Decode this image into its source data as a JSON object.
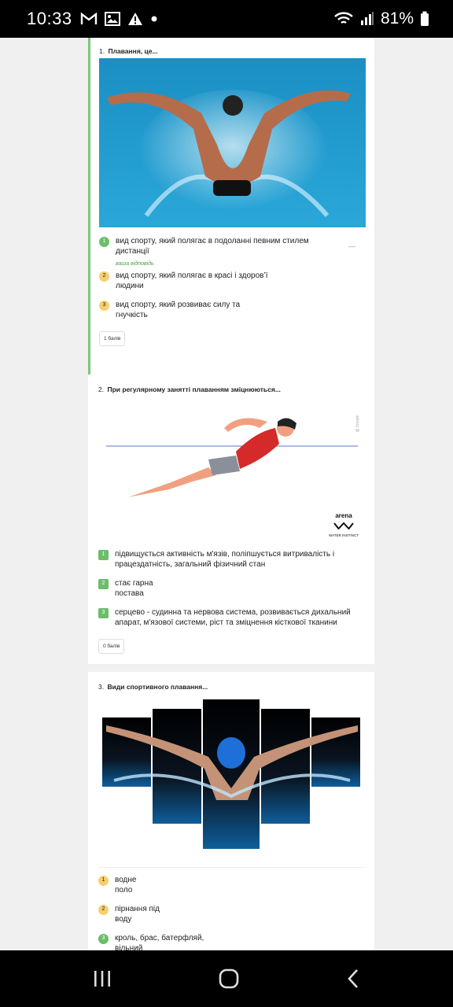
{
  "status": {
    "time": "10:33",
    "battery": "81%"
  },
  "questions": [
    {
      "number": "1.",
      "title": "Плавання, це...",
      "answers": [
        {
          "n": "1",
          "text": "вид спорту, який полягає в подоланні певним стилем дистанції"
        },
        {
          "n": "2",
          "text": "вид спорту, який полягає в красі і здоров’ї людини"
        },
        {
          "n": "3",
          "text": "вид спорту, який розвиває силу та гнучкість"
        }
      ],
      "your_answer": "ваша відповідь",
      "dash": "—",
      "score": "1 балів"
    },
    {
      "number": "2.",
      "title": "При регулярному занятті плаванням зміцнюються...",
      "image_text": {
        "brand": "arena",
        "tagline": "WATER INSTINCT",
        "watermark": "@ freepik"
      },
      "answers": [
        {
          "n": "1",
          "text": "підвищується активність м'язів, поліпшується витривалість і працездатність, загальний фізичний стан"
        },
        {
          "n": "2",
          "text": "стає гарна постава"
        },
        {
          "n": "3",
          "text": "серцево - судинна та нервова система, розвивається дихальний апарат, м'язової системи, ріст та зміцнення кісткової тканини"
        }
      ],
      "score": "0 балів"
    },
    {
      "number": "3.",
      "title": "Види спортивного плавання...",
      "answers": [
        {
          "n": "1",
          "text": "водне поло"
        },
        {
          "n": "2",
          "text": " пірнання під воду"
        },
        {
          "n": "3",
          "text": "кроль, брас, батерфляй, вільний"
        }
      ]
    }
  ],
  "colors": {
    "correct": "#6cbd6c",
    "neutral": "#f6d06e",
    "accent_border": "#7bc67b"
  }
}
